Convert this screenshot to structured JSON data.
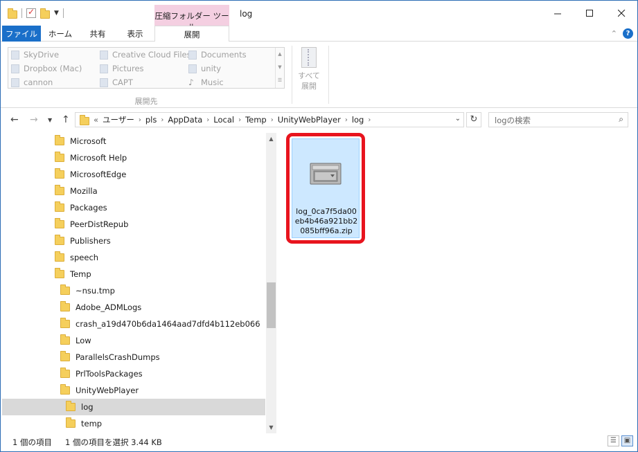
{
  "window": {
    "title": "log",
    "context_tab": "圧縮フォルダー ツール"
  },
  "ribbon_tabs": {
    "file": "ファイル",
    "home": "ホーム",
    "share": "共有",
    "view": "表示",
    "extract": "展開"
  },
  "ribbon": {
    "destinations": [
      {
        "label": "SkyDrive"
      },
      {
        "label": "Dropbox (Mac)"
      },
      {
        "label": "cannon"
      },
      {
        "label": "Creative Cloud Files"
      },
      {
        "label": "Pictures"
      },
      {
        "label": "CAPT"
      },
      {
        "label": "Documents"
      },
      {
        "label": "unity"
      },
      {
        "label": "Music"
      }
    ],
    "group_label": "展開先",
    "extract_all_label_1": "すべて",
    "extract_all_label_2": "展開"
  },
  "address": {
    "prefix": "«",
    "crumbs": [
      "ユーザー",
      "pls",
      "AppData",
      "Local",
      "Temp",
      "UnityWebPlayer",
      "log"
    ]
  },
  "search": {
    "placeholder": "logの検索"
  },
  "tree": {
    "items": [
      {
        "label": "Microsoft"
      },
      {
        "label": "Microsoft Help"
      },
      {
        "label": "MicrosoftEdge"
      },
      {
        "label": "Mozilla"
      },
      {
        "label": "Packages"
      },
      {
        "label": "PeerDistRepub"
      },
      {
        "label": "Publishers"
      },
      {
        "label": "speech"
      },
      {
        "label": "Temp"
      },
      {
        "label": "~nsu.tmp"
      },
      {
        "label": "Adobe_ADMLogs"
      },
      {
        "label": "crash_a19d470b6da1464aad7dfd4b112eb066"
      },
      {
        "label": "Low"
      },
      {
        "label": "ParallelsCrashDumps"
      },
      {
        "label": "PrlToolsPackages"
      },
      {
        "label": "UnityWebPlayer"
      },
      {
        "label": "log"
      },
      {
        "label": "temp"
      }
    ]
  },
  "content": {
    "file_name": "log_0ca7f5da00eb4b46a921bb2085bff96a.zip"
  },
  "status": {
    "item_count": "1 個の項目",
    "selection": "1 個の項目を選択  3.44 KB"
  },
  "colors": {
    "accent": "#1a6fc9",
    "context_tab": "#f4cfe1",
    "selection_fill": "#cde8ff",
    "highlight": "#e8141e"
  }
}
